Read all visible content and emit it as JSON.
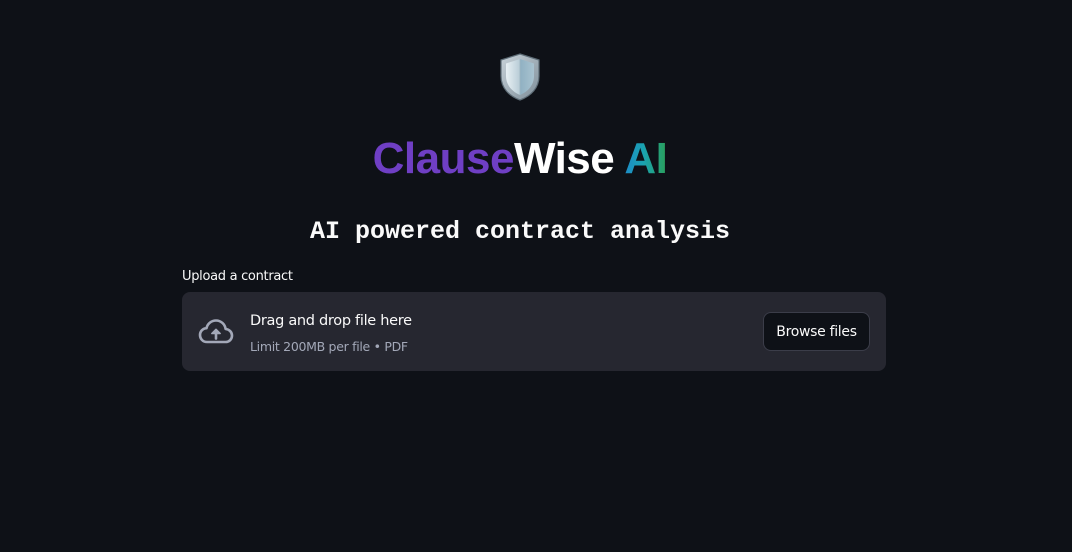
{
  "header": {
    "logo_icon": "shield-icon",
    "title_parts": [
      "Clause",
      "Wise",
      " AI"
    ],
    "subtitle": "AI powered contract analysis"
  },
  "uploader": {
    "label": "Upload a contract",
    "icon": "cloud-upload-icon",
    "drop_text": "Drag and drop file here",
    "limit_text": "Limit 200MB per file • PDF",
    "browse_label": "Browse files"
  },
  "colors": {
    "background": "#0e1117",
    "dropzone": "#262730",
    "title_clause": "#6f3fc4",
    "title_wise": "#ffffff",
    "title_ai_gradient": [
      "#1f7fd6",
      "#2aa05a"
    ]
  }
}
